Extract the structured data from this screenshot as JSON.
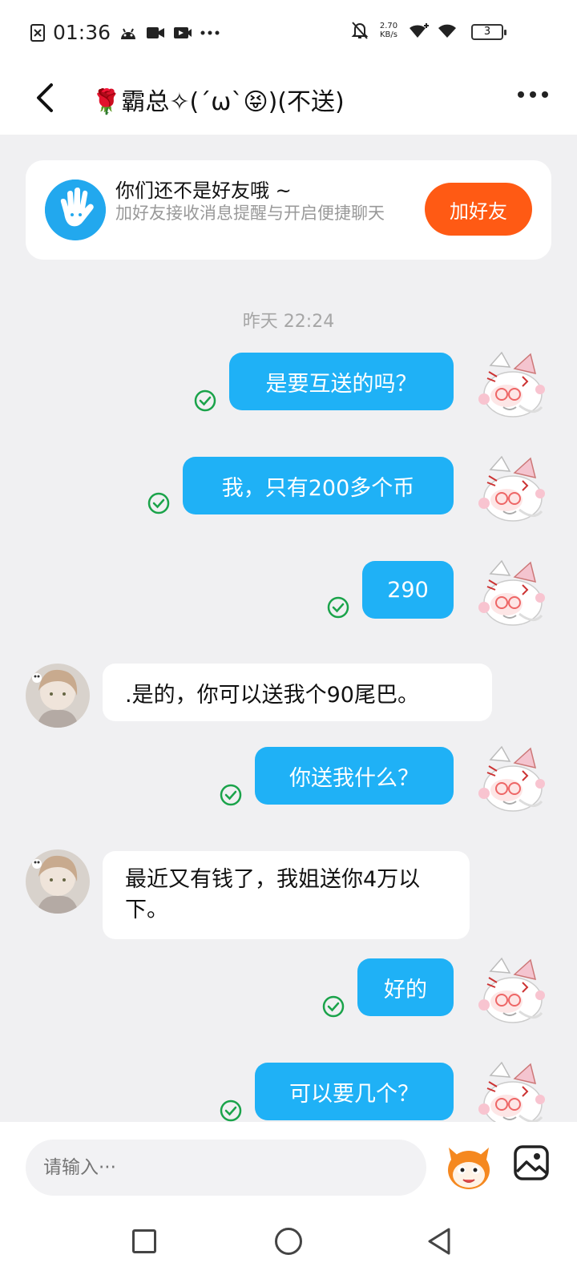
{
  "status_bar": {
    "time": "01:36",
    "speed_value": "2.70",
    "speed_unit": "KB/s",
    "battery": "3",
    "icons": [
      "close-notification-icon",
      "android-icon",
      "video-camera-icon",
      "screen-record-icon",
      "more-dots-icon",
      "mute-bell-icon",
      "wifi-plus-icon",
      "wifi-icon",
      "battery-icon"
    ]
  },
  "header": {
    "title": "🌹霸总✧(´ω`😝)(不送)"
  },
  "friend_card": {
    "title": "你们还不是好友哦 ~",
    "subtitle": "加好友接收消息提醒与开启便捷聊天",
    "button_label": "加好友"
  },
  "chat": {
    "timestamp": "昨天 22:24",
    "messages": [
      {
        "side": "out",
        "text": "是要互送的吗？"
      },
      {
        "side": "out",
        "text": "我，只有200多个币"
      },
      {
        "side": "out",
        "text": "290"
      },
      {
        "side": "in",
        "text": ".是的，你可以送我个90尾巴。"
      },
      {
        "side": "out",
        "text": "你送我什么？"
      },
      {
        "side": "in",
        "text": "最近又有钱了，我姐送你4万以下。"
      },
      {
        "side": "out",
        "text": "好的"
      },
      {
        "side": "out",
        "text": "可以要几个？"
      }
    ]
  },
  "input_bar": {
    "placeholder": "请输入···"
  },
  "colors": {
    "outgoing_bubble": "#1fb1f6",
    "add_friend_button": "#ff5a14",
    "read_check": "#1aa34a"
  }
}
